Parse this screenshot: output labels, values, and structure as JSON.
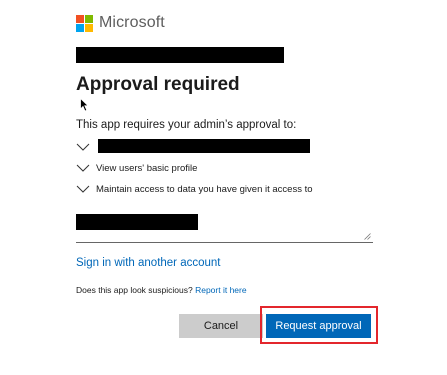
{
  "brand": {
    "name": "Microsoft",
    "logo_colors": [
      "#f25022",
      "#7fba00",
      "#00a4ef",
      "#ffb900"
    ]
  },
  "title": "Approval required",
  "intro": "This app requires your admin’s approval to:",
  "permissions": [
    {
      "label": "",
      "icon": "chevron-down-icon",
      "redacted": true
    },
    {
      "label": "View users' basic profile",
      "icon": "chevron-down-icon"
    },
    {
      "label": "Maintain access to data you have given it access to",
      "icon": "chevron-down-icon"
    }
  ],
  "justification": {
    "value": "",
    "redacted": true
  },
  "switch_account_link": "Sign in with another account",
  "suspicious": {
    "question": "Does this app look suspicious?",
    "link": "Report it here"
  },
  "buttons": {
    "cancel": "Cancel",
    "request": "Request approval"
  },
  "colors": {
    "primary": "#0067b8",
    "secondary_button": "#cccccc",
    "highlight": "#e3262c"
  }
}
